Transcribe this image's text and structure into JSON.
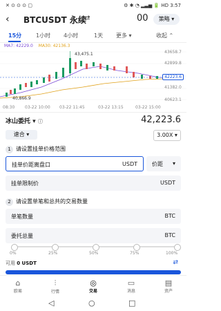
{
  "status": {
    "time": "3:57",
    "left_icons": "✕ ⊙ ⊙ ⊙ ▢",
    "right_icons": "⚙ ✱ ◔ ▂▃▅ 🔋",
    "carrier": "HD"
  },
  "header": {
    "title": "BTCUSDT 永续",
    "swap_icon": "swap-icon",
    "zero_label": "00",
    "strategy_label": "策略"
  },
  "tabs": [
    {
      "label": "15分"
    },
    {
      "label": "1小时"
    },
    {
      "label": "4小时"
    },
    {
      "label": "1天"
    },
    {
      "label": "更多"
    },
    {
      "label": "收起"
    }
  ],
  "ma": {
    "ma7": "MA7: 42229.0",
    "ma30": "MA30: 42136.3"
  },
  "chart_data": {
    "type": "candlestick",
    "title": "",
    "y_axis_labels": [
      "43658.7",
      "42899.8",
      "42223.6",
      "41382.0",
      "40623.1"
    ],
    "x_axis_labels": [
      "08:30",
      "03-22 10:00",
      "03-22 11:45",
      "03-22 13:15",
      "03-22 15:00"
    ],
    "annotations": [
      "43,475.1",
      "40,866.9"
    ],
    "current_price_label": "42223.6",
    "colors": {
      "up": "#1a9b63",
      "down": "#e05959",
      "ma7": "#7b4bd6",
      "ma30": "#e0a11a"
    }
  },
  "order": {
    "type_label": "冰山委托",
    "price": "42,223.6",
    "speed_label": "速合",
    "leverage": "3.00X",
    "step1_num": "1",
    "step1_title": "请设置挂单价格范围",
    "price_gap_label": "挂单价距离盘口",
    "price_gap_unit": "USDT",
    "price_gap_mode": "价距",
    "limit_label": "挂单限制价",
    "limit_unit": "USDT",
    "step2_num": "2",
    "step2_title": "请设置单笔和总共的交易数量",
    "single_label": "单笔数量",
    "single_unit": "BTC",
    "total_label": "委托总量",
    "total_unit": "BTC",
    "slider_marks": [
      "0%",
      "25%",
      "50%",
      "75%",
      "100%"
    ],
    "avail_label": "可用",
    "avail_value": "0 USDT"
  },
  "nav": [
    {
      "label": "欧易",
      "icon": "home-icon"
    },
    {
      "label": "行情",
      "icon": "chart-icon"
    },
    {
      "label": "交易",
      "icon": "trade-icon"
    },
    {
      "label": "消息",
      "icon": "message-icon"
    },
    {
      "label": "资产",
      "icon": "wallet-icon"
    }
  ]
}
